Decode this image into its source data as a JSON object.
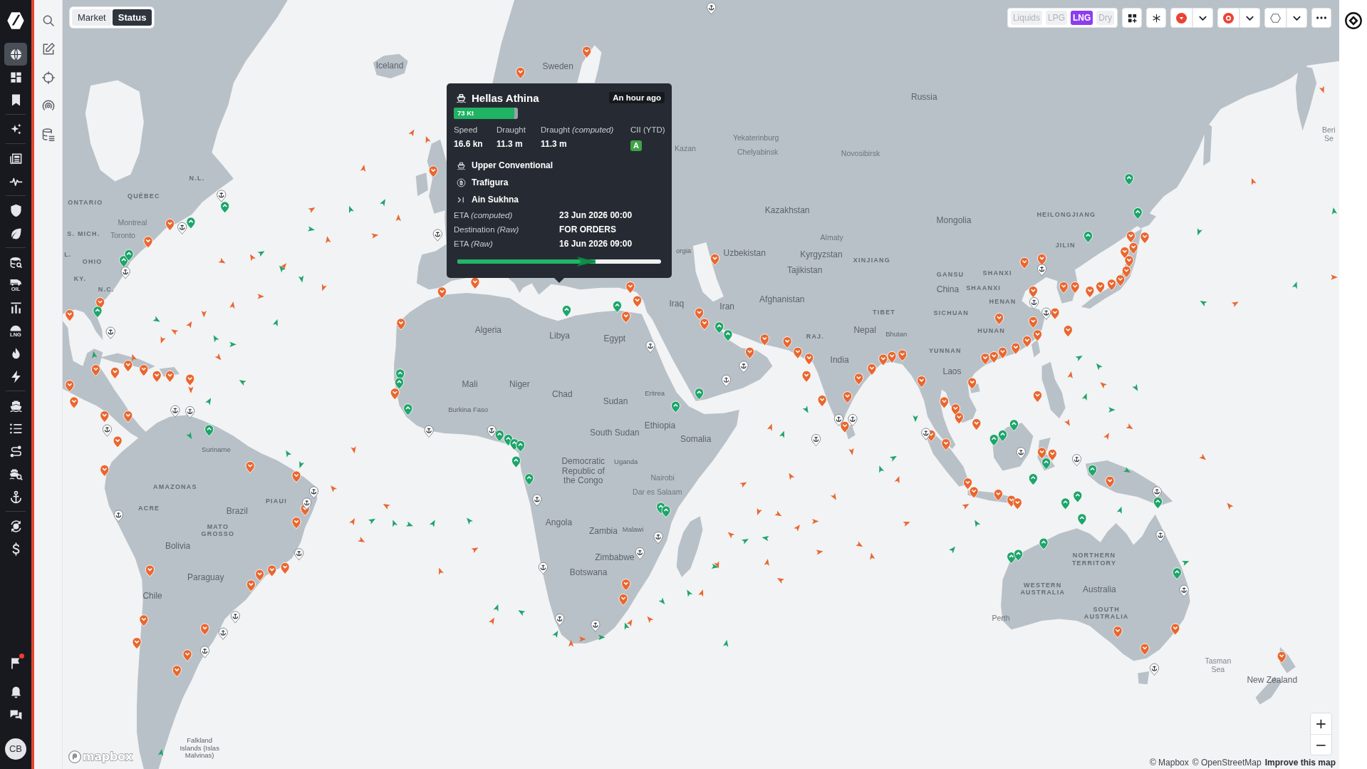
{
  "nav_rail": {
    "groups": [
      [
        {
          "selected": true
        },
        {
          "selected": false
        },
        {
          "selected": false
        }
      ],
      [
        {
          "selected": false
        }
      ],
      [
        {
          "selected": false
        },
        {
          "selected": false
        }
      ],
      [
        {
          "selected": false
        },
        {
          "selected": false
        }
      ],
      [
        {
          "selected": false
        },
        {
          "selected": false,
          "label": "OIL"
        },
        {
          "selected": false
        },
        {
          "selected": false,
          "label": "LNG"
        },
        {
          "selected": false
        },
        {
          "selected": false
        }
      ],
      [
        {
          "selected": false
        },
        {
          "selected": false
        },
        {
          "selected": false
        },
        {
          "selected": false
        },
        {
          "selected": false
        }
      ],
      [
        {
          "selected": false
        },
        {
          "selected": false
        }
      ]
    ],
    "bottom": [
      {
        "notification": true
      },
      {
        "notification": false
      },
      {
        "notification": false
      }
    ],
    "avatar": "CB"
  },
  "view_switch": [
    {
      "label": "Market",
      "selected": false
    },
    {
      "label": "Status",
      "selected": true
    }
  ],
  "toolbar": {
    "cargo_types": [
      {
        "label": "Liquids",
        "selected": false
      },
      {
        "label": "LPG",
        "selected": false
      },
      {
        "label": "LNG",
        "selected": true
      },
      {
        "label": "Dry",
        "selected": false
      }
    ]
  },
  "vessel_popup": {
    "name": "Hellas Athina",
    "updated": "An hour ago",
    "capacity": {
      "text": "73 Kt",
      "level": 0.94
    },
    "stats": [
      {
        "kind": "value",
        "label": "Speed",
        "value": "16.6 kn"
      },
      {
        "kind": "value",
        "label": "Draught",
        "value": "11.3 m"
      },
      {
        "kind": "value",
        "label": "Draught *(computed)*",
        "value": "11.3 m"
      },
      {
        "kind": "grade",
        "label": "CII (YTD)",
        "value": "A",
        "color": "#3ea447"
      }
    ],
    "details": [
      {
        "kind": "class",
        "text": "Upper Conventional"
      },
      {
        "kind": "charterer",
        "text": "Trafigura"
      },
      {
        "kind": "destination",
        "text": "Ain Sukhna"
      }
    ],
    "schedule": [
      {
        "label": "ETA *(computed)*",
        "value": "23 Jun 2026 00:00"
      },
      {
        "label": "Destination *(Raw)*",
        "value": "FOR ORDERS"
      },
      {
        "label": "ETA *(Raw)*",
        "value": "16 Jun 2026 09:00"
      }
    ],
    "voyage_progress": {
      "level": 0.68
    }
  },
  "map_labels": [
    {
      "text": "Iceland",
      "kind": "country"
    },
    {
      "text": "Sweden",
      "kind": "country"
    },
    {
      "text": "Russia",
      "kind": "country"
    },
    {
      "text": "Yekaterinburg",
      "kind": "city"
    },
    {
      "text": "Beri\nSe",
      "kind": "sea"
    },
    {
      "text": "Kazan",
      "kind": "city"
    },
    {
      "text": "Chelyabinsk",
      "kind": "city"
    },
    {
      "text": "Novosibirsk",
      "kind": "city"
    },
    {
      "text": "N.L.",
      "kind": "region"
    },
    {
      "text": "ONTARIO",
      "kind": "region"
    },
    {
      "text": "QUÉBEC",
      "kind": "region"
    },
    {
      "text": "Montreal",
      "kind": "city"
    },
    {
      "text": "Kazakhstan",
      "kind": "country"
    },
    {
      "text": "Mongolia",
      "kind": "country"
    },
    {
      "text": "HEILONGJIANG",
      "kind": "region"
    },
    {
      "text": "S. MICH.",
      "kind": "region"
    },
    {
      "text": "Toronto",
      "kind": "city"
    },
    {
      "text": "Almaty",
      "kind": "city"
    },
    {
      "text": "JILIN",
      "kind": "region"
    },
    {
      "text": "L.",
      "kind": "region"
    },
    {
      "text": "OHIO",
      "kind": "region"
    },
    {
      "text": "orgia",
      "kind": "minor"
    },
    {
      "text": "Uzbekistan",
      "kind": "country"
    },
    {
      "text": "Kyrgyzstan",
      "kind": "country"
    },
    {
      "text": "XINJIANG",
      "kind": "region"
    },
    {
      "text": "KY.",
      "kind": "region"
    },
    {
      "text": "Tajikistan",
      "kind": "country"
    },
    {
      "text": "GANSU",
      "kind": "region"
    },
    {
      "text": "SHANXI",
      "kind": "region"
    },
    {
      "text": "N.C.",
      "kind": "region"
    },
    {
      "text": "China",
      "kind": "country"
    },
    {
      "text": "SHAANXI",
      "kind": "region"
    },
    {
      "text": "Iraq",
      "kind": "country"
    },
    {
      "text": "Iran",
      "kind": "country"
    },
    {
      "text": "Afghanistan",
      "kind": "country"
    },
    {
      "text": "TIBET",
      "kind": "region"
    },
    {
      "text": "SICHUAN",
      "kind": "region"
    },
    {
      "text": "HENAN",
      "kind": "region"
    },
    {
      "text": "Algeria",
      "kind": "country"
    },
    {
      "text": "Libya",
      "kind": "country"
    },
    {
      "text": "Egypt",
      "kind": "country"
    },
    {
      "text": "RAJ.",
      "kind": "region"
    },
    {
      "text": "Nepal",
      "kind": "country"
    },
    {
      "text": "Bhutan",
      "kind": "minor"
    },
    {
      "text": "HUNAN",
      "kind": "region"
    },
    {
      "text": "YUNNAN",
      "kind": "region"
    },
    {
      "text": "India",
      "kind": "country"
    },
    {
      "text": "Laos",
      "kind": "country"
    },
    {
      "text": "Mali",
      "kind": "country"
    },
    {
      "text": "Niger",
      "kind": "country"
    },
    {
      "text": "Chad",
      "kind": "country"
    },
    {
      "text": "Sudan",
      "kind": "country"
    },
    {
      "text": "Eritrea",
      "kind": "minor"
    },
    {
      "text": "Burkina Faso",
      "kind": "minor"
    },
    {
      "text": "South Sudan",
      "kind": "country"
    },
    {
      "text": "Ethiopia",
      "kind": "country"
    },
    {
      "text": "Somalia",
      "kind": "country"
    },
    {
      "text": "Suriname",
      "kind": "minor"
    },
    {
      "text": "Democratic\nRepublic of\nthe Congo",
      "kind": "country"
    },
    {
      "text": "Uganda",
      "kind": "minor"
    },
    {
      "text": "Nairobi",
      "kind": "city"
    },
    {
      "text": "AMAZONAS",
      "kind": "region"
    },
    {
      "text": "Dar es Salaam",
      "kind": "city"
    },
    {
      "text": "ACRE",
      "kind": "region"
    },
    {
      "text": "Brazil",
      "kind": "country"
    },
    {
      "text": "PIAUI",
      "kind": "region"
    },
    {
      "text": "MATO\nGROSSO",
      "kind": "region"
    },
    {
      "text": "Angola",
      "kind": "country"
    },
    {
      "text": "Zambia",
      "kind": "country"
    },
    {
      "text": "Malawi",
      "kind": "minor"
    },
    {
      "text": "Bolivia",
      "kind": "country"
    },
    {
      "text": "Zimbabwe",
      "kind": "country"
    },
    {
      "text": "NORTHERN\nTERRITORY",
      "kind": "region"
    },
    {
      "text": "Paraguay",
      "kind": "country"
    },
    {
      "text": "Botswana",
      "kind": "country"
    },
    {
      "text": "Chile",
      "kind": "country"
    },
    {
      "text": "WESTERN\nAUSTRALIA",
      "kind": "region"
    },
    {
      "text": "Australia",
      "kind": "country"
    },
    {
      "text": "Perth",
      "kind": "city"
    },
    {
      "text": "SOUTH\nAUSTRALIA",
      "kind": "region"
    },
    {
      "text": "Tasman\nSea",
      "kind": "sea"
    },
    {
      "text": "New Zealand",
      "kind": "country"
    },
    {
      "text": "Falkland\nIslands (Islas\nMalvinas)",
      "kind": "minor"
    }
  ],
  "vessel_series": [
    {
      "kind": "arrow",
      "color": "#e9672f"
    },
    {
      "kind": "arrow",
      "color": "#1da56a"
    },
    {
      "kind": "pin",
      "color": "#e9672f",
      "laden": true
    },
    {
      "kind": "pin",
      "color": "#1da56a",
      "laden": false
    },
    {
      "kind": "anchor",
      "color": "#ffffff"
    }
  ],
  "zoom_controls": {
    "zoom_in": "+",
    "zoom_out": "−"
  },
  "map_logo": "mapbox",
  "attribution": {
    "credits": [
      "© Mapbox",
      "© OpenStreetMap"
    ],
    "link": "Improve this map"
  }
}
